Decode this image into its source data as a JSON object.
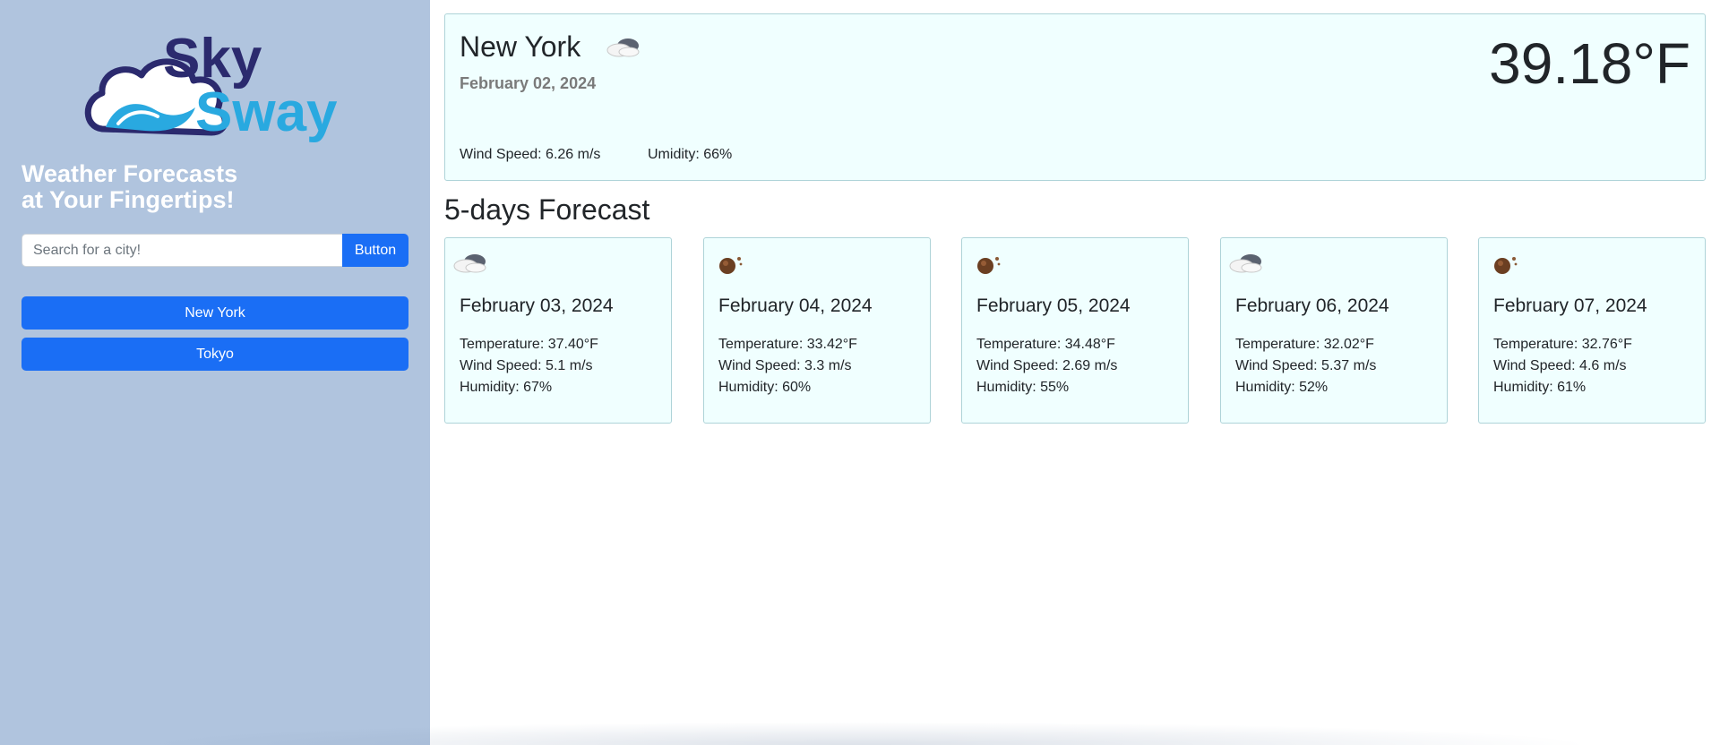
{
  "app": {
    "logo_text_top": "Sky",
    "logo_text_bottom": "Sway",
    "tagline_line1": "Weather Forecasts",
    "tagline_line2": "at Your Fingertips!"
  },
  "search": {
    "placeholder": "Search for a city!",
    "value": "",
    "button_label": "Button"
  },
  "history": [
    {
      "label": "New York"
    },
    {
      "label": "Tokyo"
    }
  ],
  "current": {
    "city": "New York",
    "icon": "cloud-icon",
    "date": "February 02, 2024",
    "temperature": "39.18°F",
    "wind": "Wind Speed: 6.26 m/s",
    "humidity": "Umidity: 66%"
  },
  "forecast": {
    "title": "5-days Forecast",
    "days": [
      {
        "icon": "cloud-icon",
        "date": "February 03, 2024",
        "temperature": "Temperature: 37.40°F",
        "wind": "Wind Speed: 5.1 m/s",
        "humidity": "Humidity: 67%"
      },
      {
        "icon": "comet-icon",
        "date": "February 04, 2024",
        "temperature": "Temperature: 33.42°F",
        "wind": "Wind Speed: 3.3 m/s",
        "humidity": "Humidity: 60%"
      },
      {
        "icon": "comet-icon",
        "date": "February 05, 2024",
        "temperature": "Temperature: 34.48°F",
        "wind": "Wind Speed: 2.69 m/s",
        "humidity": "Humidity: 55%"
      },
      {
        "icon": "cloud-icon",
        "date": "February 06, 2024",
        "temperature": "Temperature: 32.02°F",
        "wind": "Wind Speed: 5.37 m/s",
        "humidity": "Humidity: 52%"
      },
      {
        "icon": "comet-icon",
        "date": "February 07, 2024",
        "temperature": "Temperature: 32.76°F",
        "wind": "Wind Speed: 4.6 m/s",
        "humidity": "Humidity: 61%"
      }
    ]
  },
  "colors": {
    "sidebar_bg": "#b0c4de",
    "accent": "#1a6ef5",
    "card_bg": "#f0ffff",
    "card_border": "#aed3d8",
    "logo_dark": "#2b2a6e",
    "logo_light": "#29a9e0"
  }
}
